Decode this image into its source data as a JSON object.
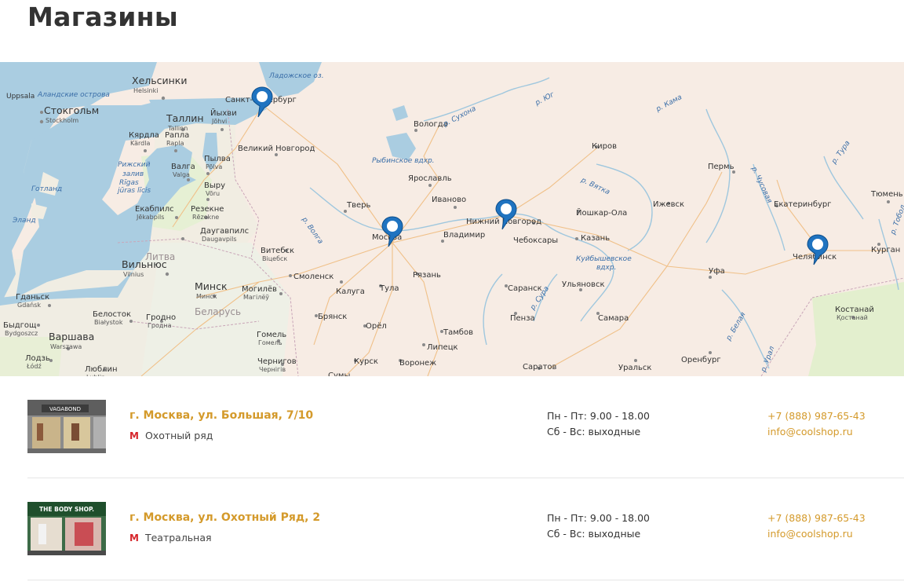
{
  "page": {
    "title": "Магазины"
  },
  "map": {
    "cities": [
      {
        "name": "Хельсинки",
        "sub": "Helsinki"
      },
      {
        "name": "Uppsala"
      },
      {
        "name": "Стокгольм",
        "sub": "Stockholm"
      },
      {
        "name": "Таллин",
        "sub": "Tallinn"
      },
      {
        "name": "Йыхви",
        "sub": "Jõhvi"
      },
      {
        "name": "Кярдла",
        "sub": "Kärdla"
      },
      {
        "name": "Рапла",
        "sub": "Rapla"
      },
      {
        "name": "Пылва",
        "sub": "Põlva"
      },
      {
        "name": "Валга",
        "sub": "Valga"
      },
      {
        "name": "Выру",
        "sub": "Võru"
      },
      {
        "name": "Екабпилс",
        "sub": "Jēkabpils"
      },
      {
        "name": "Резекне",
        "sub": "Rēzekne"
      },
      {
        "name": "Даугавпилс",
        "sub": "Daugavpils"
      },
      {
        "name": "Вильнюс",
        "sub": "Vilnius"
      },
      {
        "name": "Минск",
        "sub": "Минск"
      },
      {
        "name": "Витебск",
        "sub": "Віцебск"
      },
      {
        "name": "Могилёв",
        "sub": "Магілёў"
      },
      {
        "name": "Гомель",
        "sub": "Гомель"
      },
      {
        "name": "Чернигов",
        "sub": "Чернігів"
      },
      {
        "name": "Гродно",
        "sub": "Гродна"
      },
      {
        "name": "Белосток",
        "sub": "Białystok"
      },
      {
        "name": "Гданьск",
        "sub": "Gdańsk"
      },
      {
        "name": "Быдгощ",
        "sub": "Bydgoszcz"
      },
      {
        "name": "Варшава",
        "sub": "Warszawa"
      },
      {
        "name": "Лодзь",
        "sub": "Łódź"
      },
      {
        "name": "Люблин",
        "sub": "Lublin"
      },
      {
        "name": "Санкт-Петербург"
      },
      {
        "name": "Великий Новгород"
      },
      {
        "name": "Вологда"
      },
      {
        "name": "Ярославль"
      },
      {
        "name": "Иваново"
      },
      {
        "name": "Тверь"
      },
      {
        "name": "Москва"
      },
      {
        "name": "Владимир"
      },
      {
        "name": "Смоленск"
      },
      {
        "name": "Калуга"
      },
      {
        "name": "Тула"
      },
      {
        "name": "Рязань"
      },
      {
        "name": "Брянск"
      },
      {
        "name": "Орёл"
      },
      {
        "name": "Курск"
      },
      {
        "name": "Липецк"
      },
      {
        "name": "Тамбов"
      },
      {
        "name": "Воронеж"
      },
      {
        "name": "Нижний Новгород"
      },
      {
        "name": "Чебоксары"
      },
      {
        "name": "Киров"
      },
      {
        "name": "Йошкар-Ола"
      },
      {
        "name": "Казань"
      },
      {
        "name": "Саранск"
      },
      {
        "name": "Пенза"
      },
      {
        "name": "Ульяновск"
      },
      {
        "name": "Самара"
      },
      {
        "name": "Саратов"
      },
      {
        "name": "Ижевск"
      },
      {
        "name": "Пермь"
      },
      {
        "name": "Екатеринбург"
      },
      {
        "name": "Тюмень"
      },
      {
        "name": "Челябинск"
      },
      {
        "name": "Курган"
      },
      {
        "name": "Уфа"
      },
      {
        "name": "Оренбург"
      },
      {
        "name": "Уральск"
      },
      {
        "name": "Костанай",
        "sub": "Қостанай"
      },
      {
        "name": "Сумы"
      }
    ],
    "water_labels": [
      "Аландские острова",
      "Ладожское оз.",
      "Рижский",
      "залив",
      "Rīgas",
      "jūras līcis",
      "Готланд",
      "Эланд",
      "Рыбинское вдхр.",
      "Куйбышевское",
      "вдхр.",
      "р. Сухона",
      "р. Юг",
      "р. Кама",
      "р. Вятка",
      "р. Сура",
      "р. Волга",
      "р. Чусовая",
      "р. Тура",
      "р. Тобол",
      "р. Белая",
      "р. Урал"
    ],
    "countries": [
      "Литва",
      "Беларусь"
    ],
    "marker_names": [
      "Санкт-Петербург",
      "Москва",
      "Нижний Новгород",
      "Челябинск"
    ]
  },
  "stores": [
    {
      "address": "г. Москва, ул. Большая, 7/10",
      "metro_icon": "М",
      "metro": "Охотный ряд",
      "hours_weekdays": "Пн - Пт: 9.00 - 18.00",
      "hours_weekend": "Сб - Вс: выходные",
      "phone": "+7 (888) 987-65-43",
      "email": "info@coolshop.ru",
      "thumb_sign": "VAGABOND"
    },
    {
      "address": "г. Москва, ул. Охотный Ряд, 2",
      "metro_icon": "М",
      "metro": "Театральная",
      "hours_weekdays": "Пн - Пт: 9.00 - 18.00",
      "hours_weekend": "Сб - Вс: выходные",
      "phone": "+7 (888) 987-65-43",
      "email": "info@coolshop.ru",
      "thumb_sign": "THE BODY SHOP."
    }
  ]
}
